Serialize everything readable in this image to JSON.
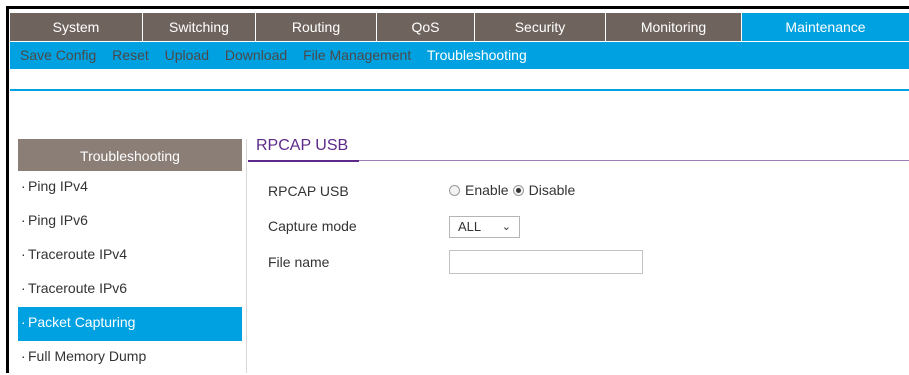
{
  "topnav": {
    "tabs": [
      {
        "label": "System",
        "width": 133
      },
      {
        "label": "Switching",
        "width": 113
      },
      {
        "label": "Routing",
        "width": 121
      },
      {
        "label": "QoS",
        "width": 98
      },
      {
        "label": "Security",
        "width": 131
      },
      {
        "label": "Monitoring",
        "width": 136
      },
      {
        "label": "Maintenance",
        "width": 137,
        "active": true
      }
    ]
  },
  "subnav": {
    "items": [
      "Save Config",
      "Reset",
      "Upload",
      "Download",
      "File Management",
      "Troubleshooting"
    ],
    "active_index": 5
  },
  "sidebar": {
    "header": "Troubleshooting",
    "items": [
      "Ping IPv4",
      "Ping IPv6",
      "Traceroute IPv4",
      "Traceroute IPv6",
      "Packet Capturing",
      "Full Memory Dump"
    ],
    "active_index": 4
  },
  "content": {
    "title": "RPCAP USB",
    "rpcap_label": "RPCAP USB",
    "enable_label": "Enable",
    "disable_label": "Disable",
    "selected": "Disable",
    "capture_mode_label": "Capture mode",
    "capture_mode_value": "ALL",
    "file_name_label": "File name",
    "file_name_value": ""
  },
  "colors": {
    "accent": "#00a1e1",
    "nav_bg": "#6f645d",
    "sidebar_header_bg": "#8b7e76",
    "title_purple": "#5e2a89"
  }
}
